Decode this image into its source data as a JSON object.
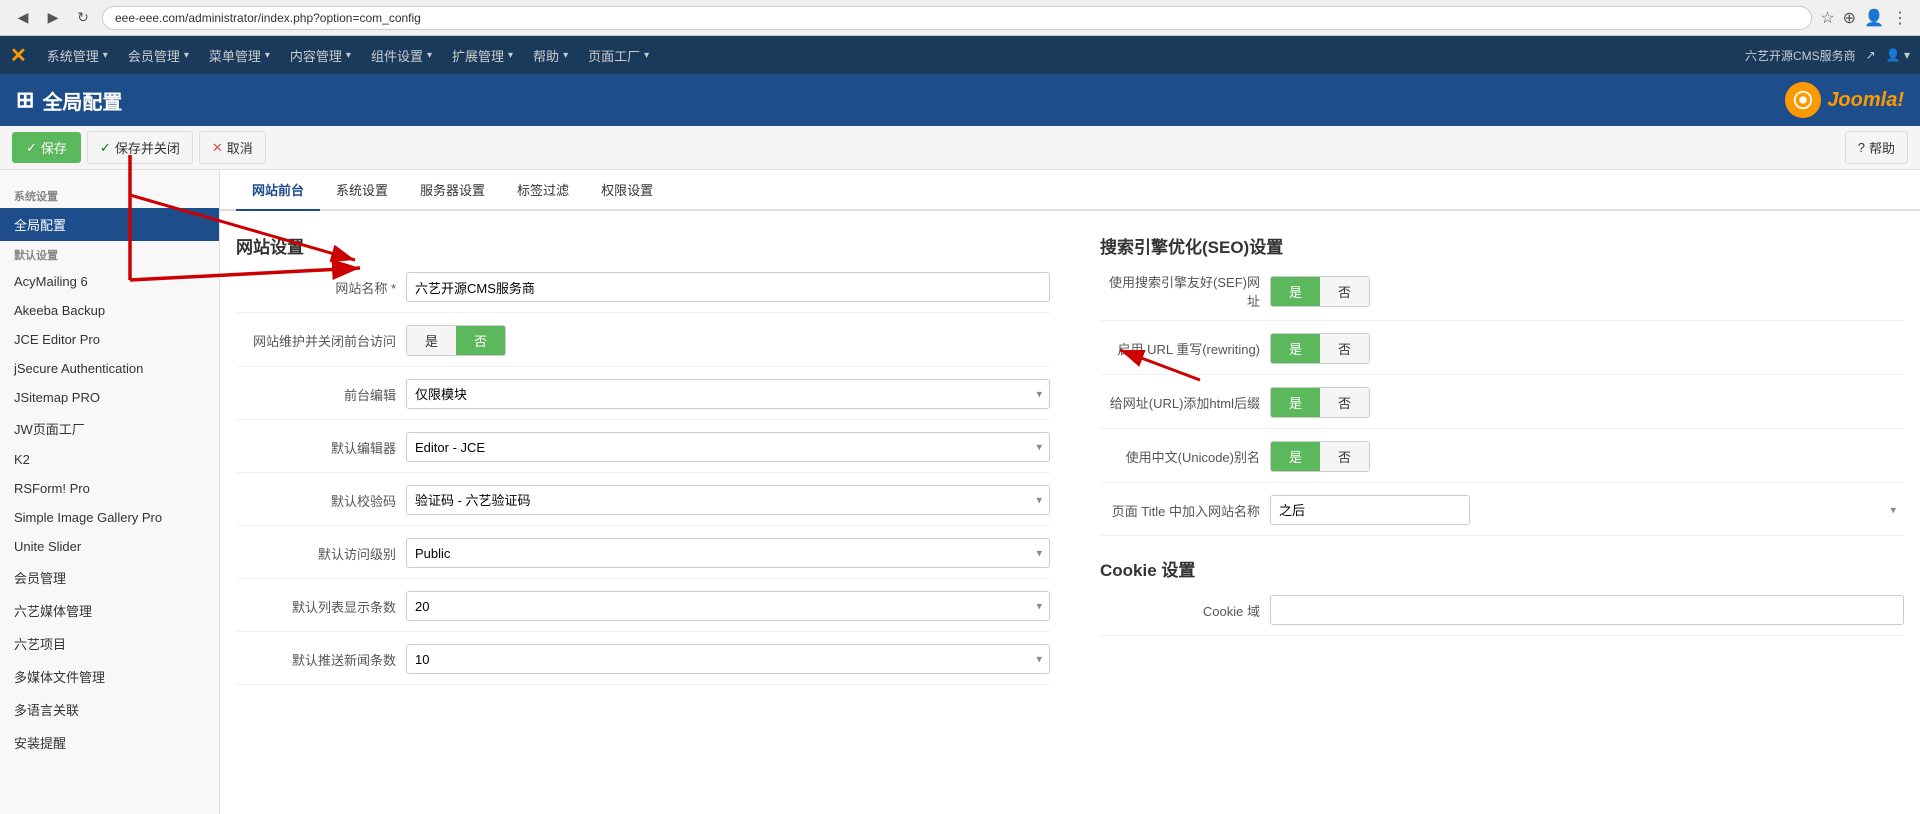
{
  "browser": {
    "back_btn": "◀",
    "forward_btn": "▶",
    "refresh_btn": "↻",
    "address": "eee-eee.com/administrator/index.php?option=com_config",
    "star_icon": "☆",
    "ext_icon": "⊕",
    "user_icon": "👤",
    "menu_icon": "⋮"
  },
  "topnav": {
    "logo": "✕",
    "items": [
      {
        "label": "系统管理",
        "has_arrow": true
      },
      {
        "label": "会员管理",
        "has_arrow": true
      },
      {
        "label": "菜单管理",
        "has_arrow": true
      },
      {
        "label": "内容管理",
        "has_arrow": true
      },
      {
        "label": "组件设置",
        "has_arrow": true
      },
      {
        "label": "扩展管理",
        "has_arrow": true
      },
      {
        "label": "帮助",
        "has_arrow": true
      },
      {
        "label": "页面工厂",
        "has_arrow": true
      }
    ],
    "right_text": "六艺开源CMS服务商",
    "right_icon": "↗",
    "user_icon": "👤"
  },
  "header": {
    "icon": "⊞",
    "title": "全局配置",
    "joomla_text": "Joomla!"
  },
  "toolbar": {
    "save_label": "保存",
    "save_close_label": "保存并关闭",
    "cancel_label": "取消",
    "help_label": "帮助",
    "save_icon": "✓",
    "save_close_icon": "✓",
    "cancel_icon": "✕",
    "help_icon": "?"
  },
  "sidebar": {
    "section_title": "系统设置",
    "active_item": "全局配置",
    "items": [
      {
        "label": "全局配置",
        "active": true
      },
      {
        "label": "默认设置",
        "active": false
      },
      {
        "label": "AcyMailing 6",
        "active": false
      },
      {
        "label": "Akeeba Backup",
        "active": false
      },
      {
        "label": "JCE Editor Pro",
        "active": false
      },
      {
        "label": "jSecure Authentication",
        "active": false
      },
      {
        "label": "JSitemap PRO",
        "active": false
      },
      {
        "label": "JW页面工厂",
        "active": false
      },
      {
        "label": "K2",
        "active": false
      },
      {
        "label": "RSForm! Pro",
        "active": false
      },
      {
        "label": "Simple Image Gallery Pro",
        "active": false
      },
      {
        "label": "Unite Slider",
        "active": false
      },
      {
        "label": "会员管理",
        "active": false
      },
      {
        "label": "六艺媒体管理",
        "active": false
      },
      {
        "label": "六艺项目",
        "active": false
      },
      {
        "label": "多媒体文件管理",
        "active": false
      },
      {
        "label": "多语言关联",
        "active": false
      },
      {
        "label": "安装提醒",
        "active": false
      }
    ]
  },
  "tabs": [
    {
      "label": "网站前台",
      "active": true
    },
    {
      "label": "系统设置",
      "active": false
    },
    {
      "label": "服务器设置",
      "active": false
    },
    {
      "label": "标签过滤",
      "active": false
    },
    {
      "label": "权限设置",
      "active": false
    }
  ],
  "left_section": {
    "title": "网站设置",
    "fields": [
      {
        "label": "网站名称 *",
        "type": "input",
        "value": "六艺开源CMS服务商"
      },
      {
        "label": "网站维护并关闭前台访问",
        "type": "toggle",
        "yes_label": "是",
        "no_label": "否",
        "active": "no"
      },
      {
        "label": "前台编辑",
        "type": "select",
        "value": "仅限模块"
      },
      {
        "label": "默认编辑器",
        "type": "select",
        "value": "Editor - JCE"
      },
      {
        "label": "默认校验码",
        "type": "select",
        "value": "验证码 - 六艺验证码"
      },
      {
        "label": "默认访问级别",
        "type": "select",
        "value": "Public"
      },
      {
        "label": "默认列表显示条数",
        "type": "select",
        "value": "20"
      },
      {
        "label": "默认推送新闻条数",
        "type": "select",
        "value": "10"
      }
    ]
  },
  "right_section": {
    "title": "搜索引擎优化(SEO)设置",
    "fields": [
      {
        "label": "使用搜索引擎友好(SEF)网址",
        "type": "toggle",
        "yes_label": "是",
        "no_label": "否",
        "active": "yes"
      },
      {
        "label": "启用 URL 重写(rewriting)",
        "type": "toggle",
        "yes_label": "是",
        "no_label": "否",
        "active": "yes"
      },
      {
        "label": "给网址(URL)添加html后缀",
        "type": "toggle",
        "yes_label": "是",
        "no_label": "否",
        "active": "yes"
      },
      {
        "label": "使用中文(Unicode)别名",
        "type": "toggle",
        "yes_label": "是",
        "no_label": "否",
        "active": "yes"
      },
      {
        "label": "页面 Title 中加入网站名称",
        "type": "select",
        "value": "之后"
      }
    ],
    "cookie_title": "Cookie 设置",
    "cookie_fields": [
      {
        "label": "Cookie 域",
        "type": "input",
        "value": ""
      }
    ]
  }
}
